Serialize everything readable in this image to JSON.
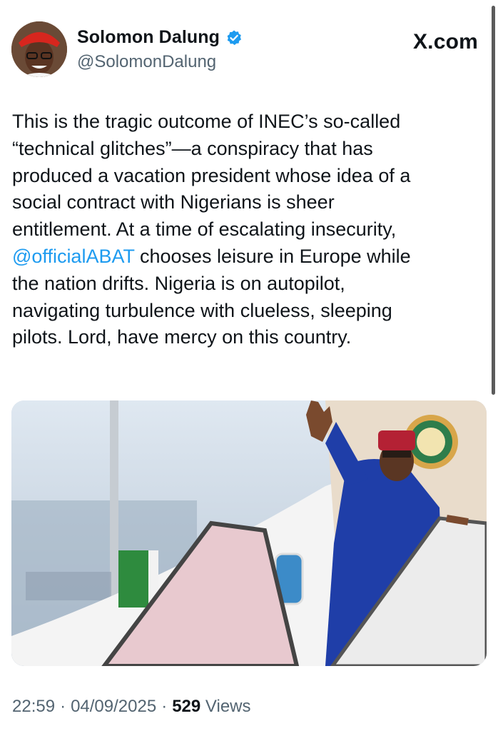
{
  "author": {
    "name": "Solomon Dalung",
    "handle": "@SolomonDalung",
    "verified_icon": "verified-badge-icon",
    "avatar": "profile-photo"
  },
  "site": {
    "label": "X.com"
  },
  "tweet": {
    "text_before": "This is the tragic outcome of INEC’s so-called\n“technical glitches”—a conspiracy that has\nproduced a vacation president whose idea of a\nsocial contract with Nigerians is sheer\nentitlement. At a time of escalating insecurity,\n",
    "mention": "@officialABAT",
    "text_after": " chooses leisure in Europe while\nthe nation drifts. Nigeria is on autopilot,\nnavigating turbulence with clueless, sleeping\npilots. Lord, have mercy on this country."
  },
  "meta": {
    "time": "22:59",
    "date": "04/09/2025",
    "views_count": "529",
    "views_label": "Views",
    "separator": "·"
  },
  "colors": {
    "accent": "#1d9bf0",
    "text": "#0f1419",
    "secondary": "#536471"
  }
}
